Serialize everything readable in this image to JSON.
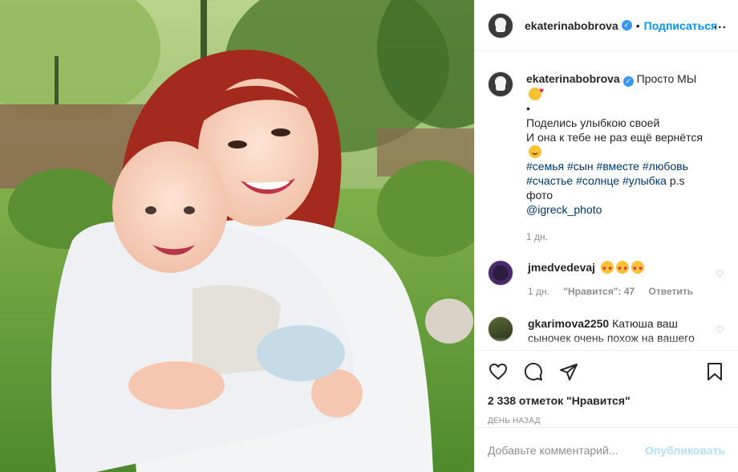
{
  "header": {
    "username": "ekaterinabobrova",
    "separator": "•",
    "follow_label": "Подписаться",
    "more_label": "..."
  },
  "caption": {
    "username": "ekaterinabobrova",
    "title": "Просто МЫ",
    "bullet": "•",
    "line1": "Поделись улыбкою своей",
    "line2": "И она к тебе не раз ещё вернётся",
    "hashtags": [
      "#семья",
      "#сын",
      "#вместе",
      "#любовь",
      "#счастье",
      "#солнце",
      "#улыбка"
    ],
    "ps": "p.s фото",
    "mention": "@igreck_photo",
    "time": "1 дн."
  },
  "comments": [
    {
      "username": "jmedvedevaj",
      "text": "",
      "time": "1 дн.",
      "likes": "\"Нравится\": 47",
      "reply": "Ответить"
    },
    {
      "username": "gkarimova2250",
      "text": "Катюша ваш сыночек очень похож на вашего папу. Мне одной так кажется или нет?",
      "time": "",
      "likes": "",
      "reply": ""
    }
  ],
  "actions": {
    "likes_text": "2 338 отметок \"Нравится\"",
    "date": "ДЕНЬ НАЗАД"
  },
  "add_comment": {
    "placeholder": "Добавьте комментарий...",
    "publish_label": "Опубликовать"
  },
  "colors": {
    "link_blue": "#0095f6",
    "hashtag": "#00376b",
    "muted": "#8e8e8e",
    "publish_disabled": "#b2dffc",
    "verified": "#3897f0"
  }
}
